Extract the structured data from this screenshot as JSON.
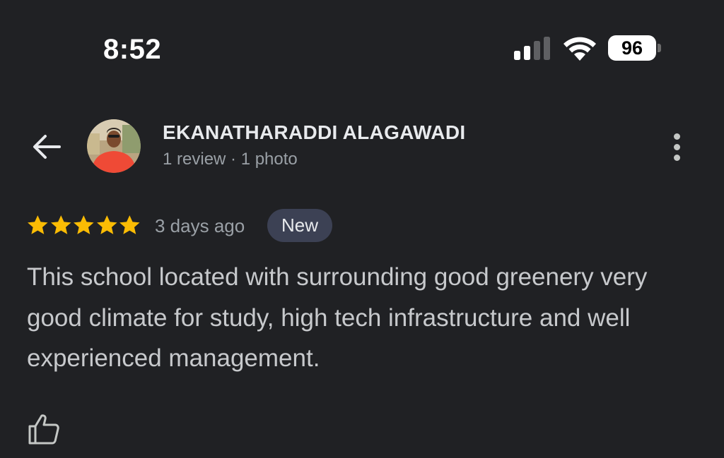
{
  "status_bar": {
    "time": "8:52",
    "battery_level": "96",
    "icons": [
      "cellular-signal-icon",
      "wifi-icon",
      "battery-icon"
    ]
  },
  "header": {
    "back_icon": "arrow-left-icon",
    "reviewer_name": "EKANATHARADDI ALAGAWADI",
    "reviewer_meta": "1 review · 1 photo",
    "more_icon": "more-vertical-icon"
  },
  "review": {
    "rating": 5,
    "rating_max": 5,
    "date": "3 days ago",
    "badge": "New",
    "text": "This school located with surrounding good greenery very good climate for study, high tech infrastructure and well experienced management.",
    "like_icon": "thumbs-up-icon"
  },
  "colors": {
    "background": "#202124",
    "star": "#fbbc04",
    "badge_bg": "#3c4154",
    "primary_text": "#e8eaed",
    "secondary_text": "#9aa0a6"
  }
}
